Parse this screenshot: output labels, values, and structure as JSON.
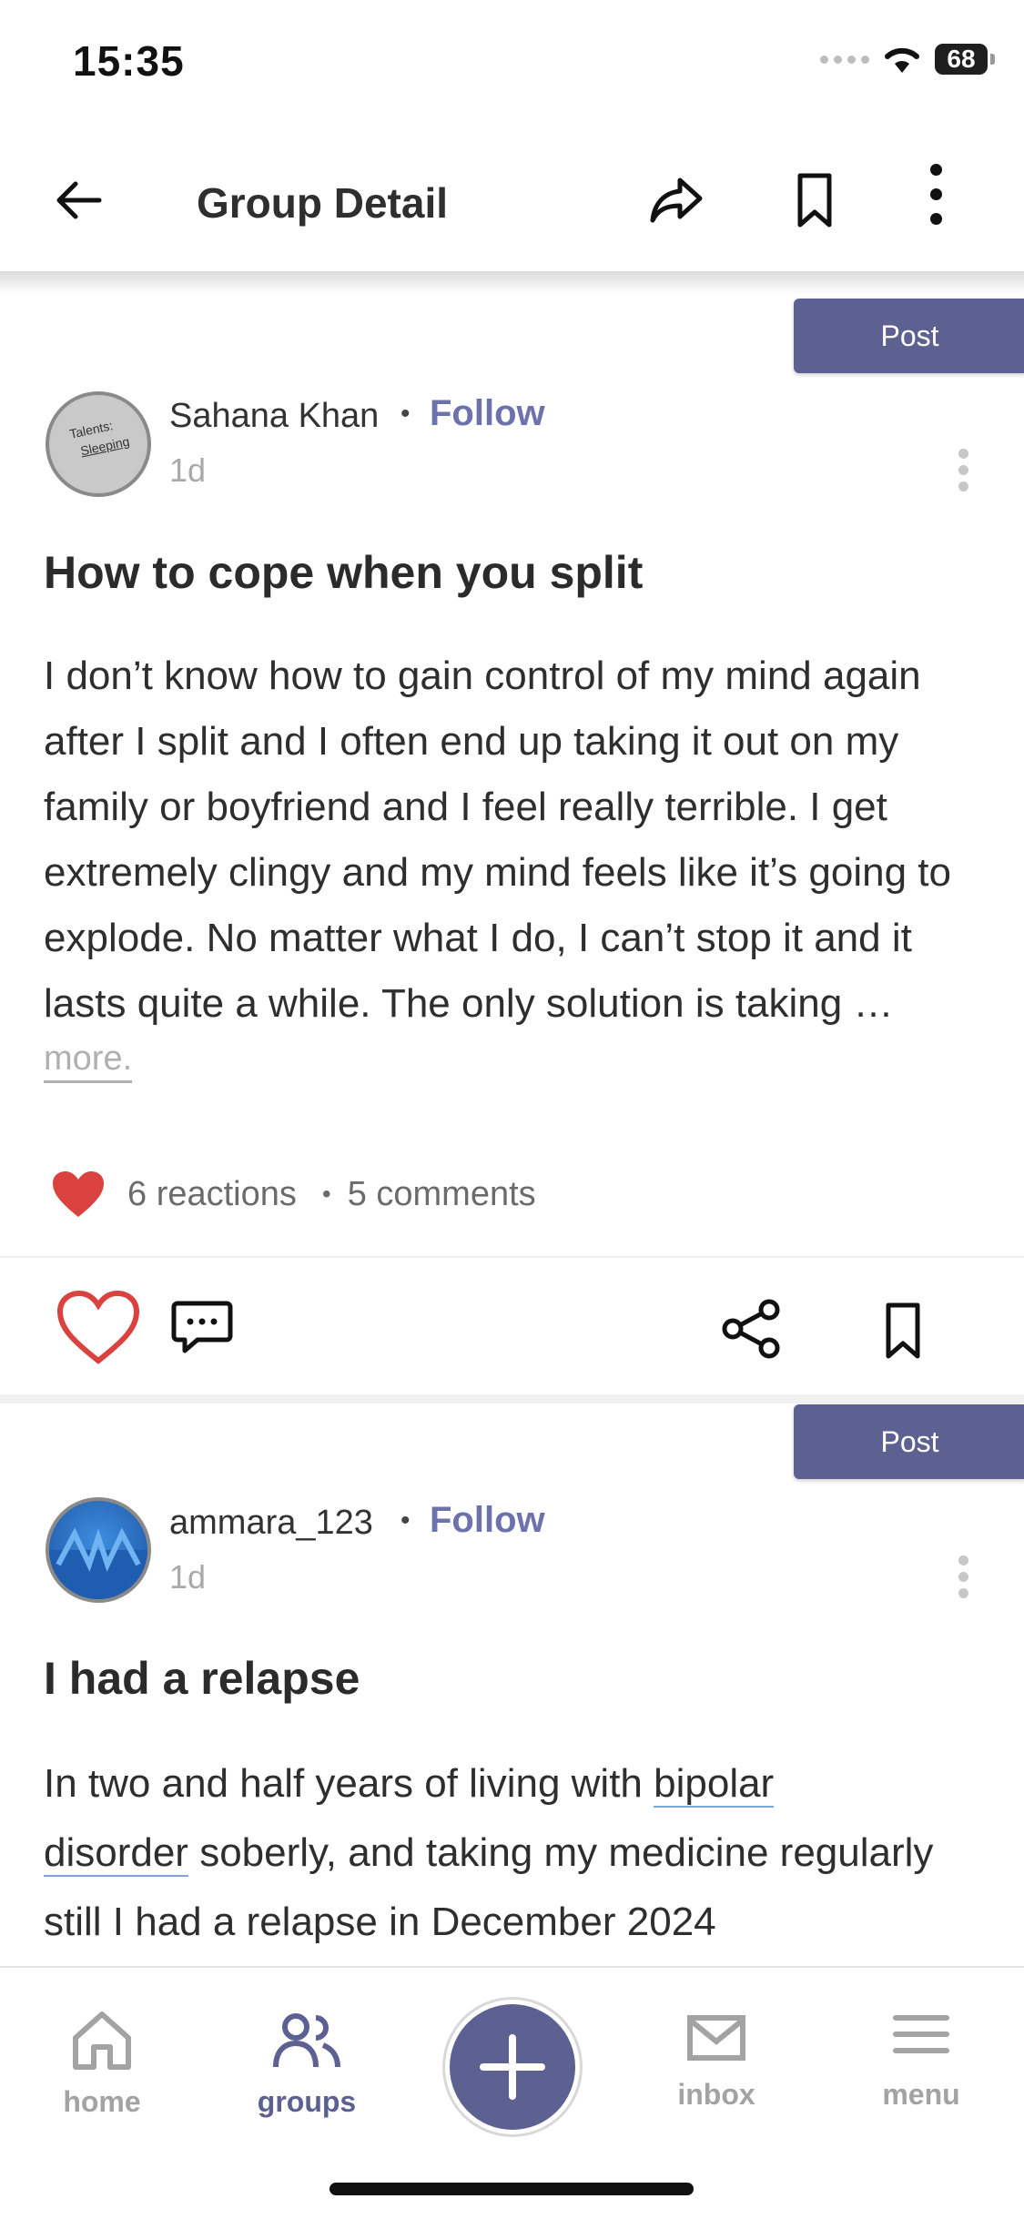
{
  "status_bar": {
    "time": "15:35",
    "battery": "68"
  },
  "header": {
    "title": "Group Detail"
  },
  "posts": [
    {
      "post_button": "Post",
      "author": "Sahana Khan",
      "follow": "Follow",
      "time": "1d",
      "avatar_text_1": "Talents:",
      "avatar_text_2": "Sleeping",
      "title": "How to cope when you split",
      "body": "I don’t know how to gain control of my mind again after I split and I often end up taking it out on my family or boyfriend and I feel really terrible. I get extremely clingy and my mind feels like it’s going to explode. No matter what I do, I can’t stop it and it lasts quite a while. The only solution is taking …",
      "more": "more.",
      "reactions": "6 reactions",
      "comments": "5 comments"
    },
    {
      "post_button": "Post",
      "author": "ammara_123",
      "follow": "Follow",
      "time": "1d",
      "title": "I had a relapse",
      "body_before": "In two and half years of living with ",
      "body_link_1": "bipolar",
      "body_link_2": "disorder",
      "body_after": " soberly, and taking my medicine regularly still I had a relapse in December 2024"
    }
  ],
  "bottom_nav": {
    "home": "home",
    "groups": "groups",
    "inbox": "inbox",
    "menu": "menu"
  },
  "colors": {
    "accent": "#5d6191",
    "heart": "#d9423f",
    "follow": "#6d72ad"
  },
  "icons": [
    "back-arrow-icon",
    "share-arrow-icon",
    "bookmark-icon",
    "more-vertical-icon",
    "heart-icon",
    "comment-icon",
    "share-nodes-icon",
    "home-icon",
    "groups-icon",
    "plus-icon",
    "inbox-icon",
    "menu-icon"
  ]
}
